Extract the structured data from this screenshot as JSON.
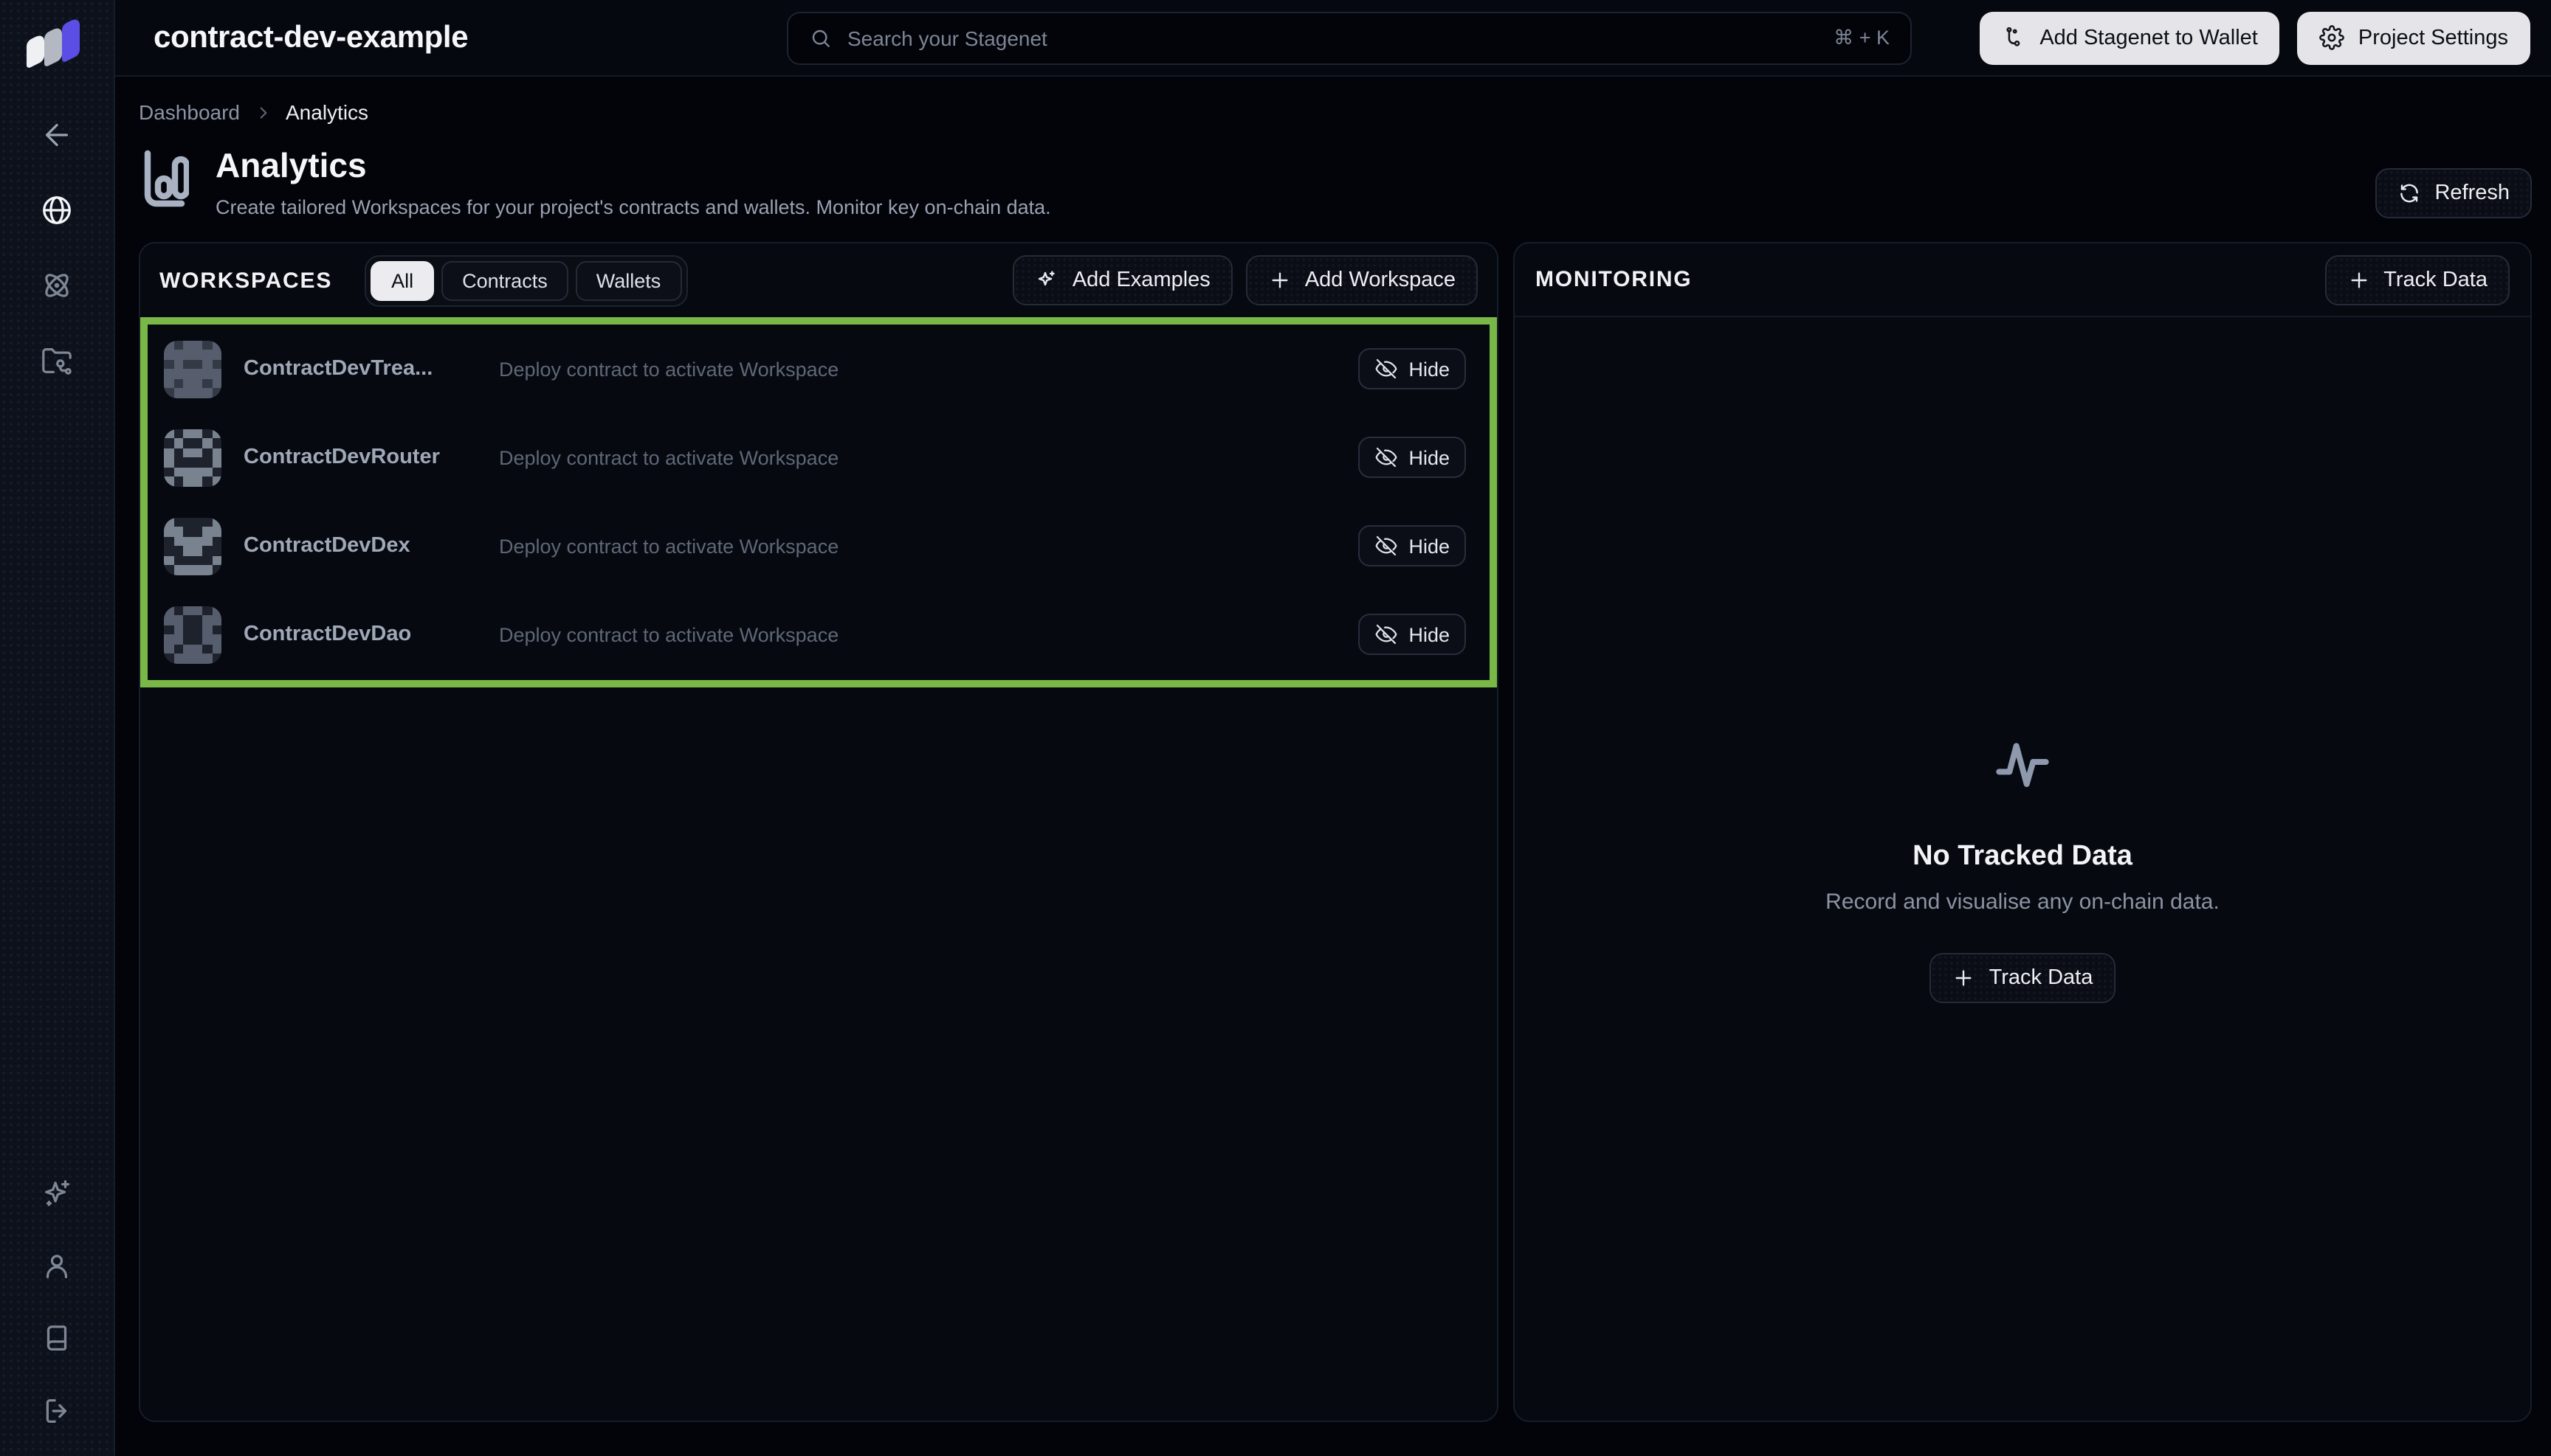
{
  "header": {
    "project_name": "contract-dev-example",
    "search": {
      "placeholder": "Search your Stagenet",
      "shortcut": "⌘ + K"
    },
    "buttons": {
      "add_to_wallet": "Add Stagenet to Wallet",
      "project_settings": "Project Settings"
    }
  },
  "breadcrumb": {
    "items": [
      "Dashboard",
      "Analytics"
    ]
  },
  "page": {
    "title": "Analytics",
    "subtitle": "Create tailored Workspaces for your project's contracts and wallets. Monitor key on-chain data.",
    "refresh_label": "Refresh"
  },
  "workspaces": {
    "section_title": "WORKSPACES",
    "filters": [
      "All",
      "Contracts",
      "Wallets"
    ],
    "active_filter": "All",
    "add_examples_label": "Add Examples",
    "add_workspace_label": "Add Workspace",
    "hide_label": "Hide",
    "highlight_color": "#79b846",
    "items": [
      {
        "name": "ContractDevTrea...",
        "description": "Deploy contract to activate Workspace"
      },
      {
        "name": "ContractDevRouter",
        "description": "Deploy contract to activate Workspace"
      },
      {
        "name": "ContractDevDex",
        "description": "Deploy contract to activate Workspace"
      },
      {
        "name": "ContractDevDao",
        "description": "Deploy contract to activate Workspace"
      }
    ],
    "avatar_palette": {
      "1": "#565e6d",
      "2": "#333945",
      "3": "#79828f",
      "4": "#1d222c"
    },
    "avatar_grids": [
      [
        1,
        2,
        1,
        1,
        2,
        1,
        1,
        1,
        1,
        1,
        1,
        1,
        2,
        1,
        2,
        2,
        1,
        2,
        1,
        1,
        1,
        1,
        1,
        1,
        1,
        2,
        1,
        1,
        2,
        1,
        2,
        1,
        1,
        1,
        1,
        2
      ],
      [
        3,
        4,
        3,
        3,
        4,
        3,
        4,
        3,
        4,
        4,
        3,
        4,
        3,
        4,
        3,
        3,
        4,
        3,
        3,
        4,
        4,
        4,
        4,
        3,
        4,
        3,
        3,
        3,
        3,
        4,
        3,
        4,
        3,
        3,
        4,
        3
      ],
      [
        3,
        4,
        4,
        4,
        4,
        3,
        3,
        3,
        4,
        4,
        3,
        3,
        4,
        3,
        3,
        3,
        3,
        4,
        4,
        4,
        3,
        3,
        4,
        4,
        3,
        4,
        4,
        4,
        4,
        3,
        4,
        3,
        3,
        3,
        3,
        4
      ],
      [
        1,
        4,
        1,
        1,
        4,
        1,
        1,
        1,
        4,
        4,
        1,
        1,
        4,
        1,
        4,
        4,
        1,
        4,
        1,
        1,
        4,
        4,
        1,
        1,
        1,
        4,
        1,
        1,
        4,
        1,
        4,
        1,
        1,
        1,
        1,
        4
      ]
    ]
  },
  "monitoring": {
    "section_title": "MONITORING",
    "track_data_label": "Track Data",
    "empty": {
      "title": "No Tracked Data",
      "description": "Record and visualise any on-chain data.",
      "cta_label": "Track Data"
    }
  },
  "icons": {
    "logo": "stacked-arrows-logo",
    "search": "magnifier",
    "back": "arrow-left",
    "network": "globe",
    "stagenet": "atom",
    "contracts": "folder-git",
    "ai": "sparkles",
    "account": "user",
    "docs": "book",
    "logout": "log-out",
    "add_to_wallet": "git-branch",
    "settings": "gear",
    "analytics": "bar-chart",
    "refresh": "refresh-arrows",
    "add": "plus",
    "hide": "eye-off",
    "empty_monitoring": "activity-pulse",
    "breadcrumb_separator": "chevron-right"
  }
}
